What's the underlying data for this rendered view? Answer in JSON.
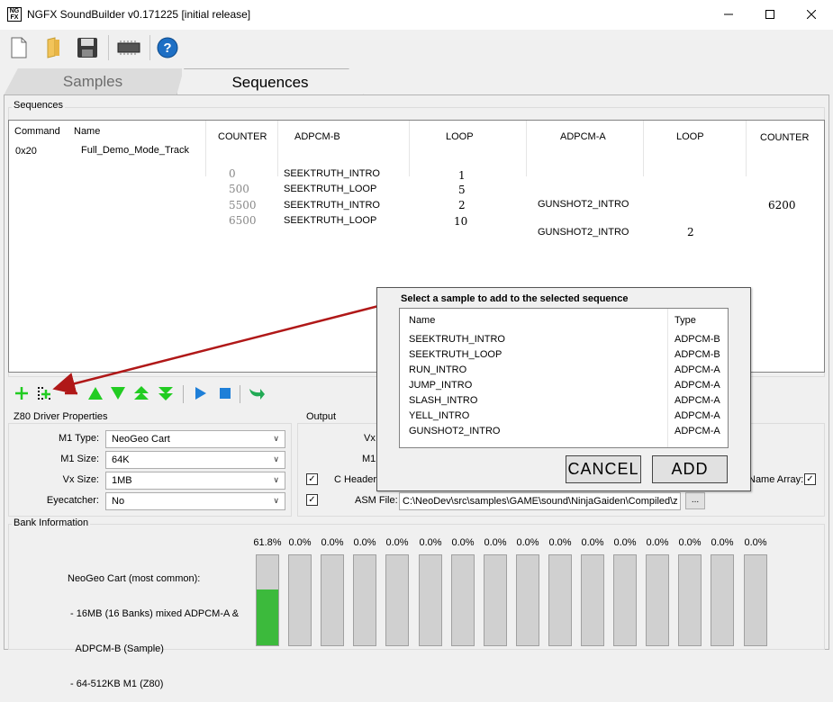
{
  "window": {
    "title": "NGFX SoundBuilder v0.171225 [initial release]",
    "icon_text": "NG FX",
    "controls": {
      "minimize": "minimize-icon",
      "maximize": "maximize-icon",
      "close": "close-icon"
    }
  },
  "toolbar": {
    "icons": [
      "new-file-icon",
      "open-folder-icon",
      "save-icon",
      "chip-icon",
      "help-icon"
    ]
  },
  "tabs": [
    {
      "label": "Samples",
      "active": false
    },
    {
      "label": "Sequences",
      "active": true
    }
  ],
  "sequences": {
    "group_label": "Sequences",
    "headers": {
      "command": "Command",
      "name": "Name",
      "counter_b": "COUNTER",
      "adpcm_b": "ADPCM-B",
      "loop_b": "LOOP",
      "adpcm_a": "ADPCM-A",
      "loop_a": "LOOP",
      "counter_a": "COUNTER"
    },
    "command": "0x20",
    "name": "Full_Demo_Mode_Track",
    "counter_b_values": [
      "0",
      "500",
      "5500",
      "6500"
    ],
    "adpcm_b_values": [
      "SEEKTRUTH_INTRO",
      "SEEKTRUTH_LOOP",
      "SEEKTRUTH_INTRO",
      "SEEKTRUTH_LOOP"
    ],
    "loop_b_values": [
      "1",
      "5",
      "2",
      "10"
    ],
    "adpcm_a_values": [
      "GUNSHOT2_INTRO",
      "GUNSHOT2_INTRO"
    ],
    "loop_a_values": [
      "2"
    ],
    "counter_a_values": [
      "6200"
    ]
  },
  "actions": {
    "icons": [
      "add-icon",
      "add-sample-icon",
      "remove-icon",
      "move-up-icon",
      "move-down-icon",
      "move-top-icon",
      "move-bottom-icon",
      "play-icon",
      "stop-icon",
      "export-arrow-icon"
    ]
  },
  "z80": {
    "group_label": "Z80 Driver Properties",
    "m1_type": {
      "label": "M1 Type:",
      "value": "NeoGeo Cart"
    },
    "m1_size": {
      "label": "M1 Size:",
      "value": "64K"
    },
    "vx_size": {
      "label": "Vx Size:",
      "value": "1MB"
    },
    "eyecatcher": {
      "label": "Eyecatcher:",
      "value": "No"
    }
  },
  "output": {
    "group_label": "Output",
    "vx_label": "Vx",
    "m1_label": "M1",
    "c_header_label": "C Header",
    "c_header_checked": true,
    "asm_label": "ASM File:",
    "asm_checked": true,
    "asm_path": "C:\\NeoDev\\src\\samples\\GAME\\sound\\NinjaGaiden\\Compiled\\z",
    "browse_label": "...",
    "name_array_label": "Name Array:",
    "name_array_checked": true
  },
  "bank": {
    "group_label": "Bank Information",
    "description": [
      "NeoGeo Cart (most common):",
      " - 16MB (16 Banks) mixed ADPCM-A &",
      "   ADPCM-B (Sample)",
      " - 64-512KB M1 (Z80)"
    ],
    "usage": [
      {
        "label": "61.8%",
        "fraction": 0.618
      },
      {
        "label": "0.0%",
        "fraction": 0
      },
      {
        "label": "0.0%",
        "fraction": 0
      },
      {
        "label": "0.0%",
        "fraction": 0
      },
      {
        "label": "0.0%",
        "fraction": 0
      },
      {
        "label": "0.0%",
        "fraction": 0
      },
      {
        "label": "0.0%",
        "fraction": 0
      },
      {
        "label": "0.0%",
        "fraction": 0
      },
      {
        "label": "0.0%",
        "fraction": 0
      },
      {
        "label": "0.0%",
        "fraction": 0
      },
      {
        "label": "0.0%",
        "fraction": 0
      },
      {
        "label": "0.0%",
        "fraction": 0
      },
      {
        "label": "0.0%",
        "fraction": 0
      },
      {
        "label": "0.0%",
        "fraction": 0
      },
      {
        "label": "0.0%",
        "fraction": 0
      },
      {
        "label": "0.0%",
        "fraction": 0
      }
    ]
  },
  "dialog": {
    "title": "Select a sample to add to the selected  sequence",
    "header_name": "Name",
    "header_type": "Type",
    "items": [
      {
        "name": "SEEKTRUTH_INTRO",
        "type": "ADPCM-B"
      },
      {
        "name": "SEEKTRUTH_LOOP",
        "type": "ADPCM-B"
      },
      {
        "name": "RUN_INTRO",
        "type": "ADPCM-A"
      },
      {
        "name": "JUMP_INTRO",
        "type": "ADPCM-A"
      },
      {
        "name": "SLASH_INTRO",
        "type": "ADPCM-A"
      },
      {
        "name": "YELL_INTRO",
        "type": "ADPCM-A"
      },
      {
        "name": "GUNSHOT2_INTRO",
        "type": "ADPCM-A"
      }
    ],
    "cancel_label": "CANCEL",
    "add_label": "ADD"
  },
  "colors": {
    "accent_green": "#22cc22",
    "bank_fill": "#3cba3c",
    "arrow_red": "#b01818",
    "blue": "#1e7fd8"
  }
}
